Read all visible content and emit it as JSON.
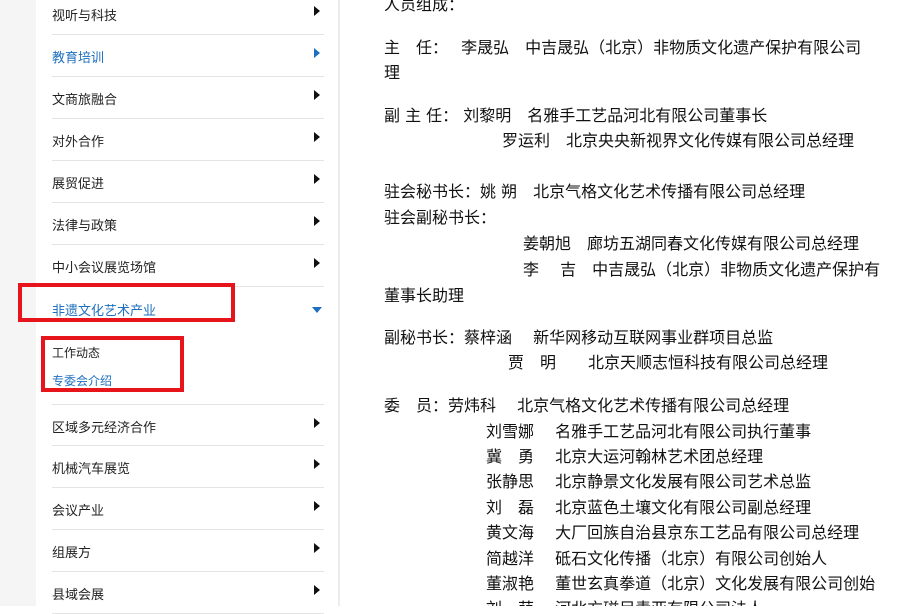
{
  "sidebar": {
    "items": [
      {
        "label": "视听与科技",
        "state": "collapsed"
      },
      {
        "label": "教育培训",
        "state": "collapsed",
        "highlight": true
      },
      {
        "label": "文商旅融合",
        "state": "collapsed"
      },
      {
        "label": "对外合作",
        "state": "collapsed"
      },
      {
        "label": "展贸促进",
        "state": "collapsed"
      },
      {
        "label": "法律与政策",
        "state": "collapsed"
      },
      {
        "label": "中小会议展览场馆",
        "state": "collapsed"
      },
      {
        "label": "非遗文化艺术产业",
        "state": "expanded",
        "highlight": true
      },
      {
        "label": "区域多元经济合作",
        "state": "collapsed"
      },
      {
        "label": "机械汽车展览",
        "state": "collapsed"
      },
      {
        "label": "会议产业",
        "state": "collapsed"
      },
      {
        "label": "组展方",
        "state": "collapsed"
      },
      {
        "label": "县域会展",
        "state": "collapsed"
      }
    ],
    "subitems": [
      {
        "label": "工作动态"
      },
      {
        "label": "专委会介绍",
        "active": true
      }
    ]
  },
  "content": {
    "lines": [
      "人员组成：",
      "主　任：　 李晟弘　中吉晟弘（北京）非物质文化遗产保护有限公司",
      "理",
      "副 主 任：  刘黎明　名雅手工艺品河北有限公司董事长",
      "罗运利　北京央央新视界文化传媒有限公司总经理",
      "驻会秘书长：姚  朔　北京气格文化艺术传播有限公司总经理",
      "驻会副秘书长：",
      "姜朝旭　廊坊五湖同春文化传媒有限公司总经理",
      "李　 吉　中吉晟弘（北京）非物质文化遗产保护有",
      "董事长助理",
      "副秘书长：蔡梓涵　 新华网移动互联网事业群项目总监",
      "贾　明　　北京天顺志恒科技有限公司总经理",
      "委　员：劳炜科　 北京气格文化艺术传播有限公司总经理",
      "刘雪娜　 名雅手工艺品河北有限公司执行董事",
      "冀　勇　 北京大运河翰林艺术团总经理",
      "张静思　 北京静景文化发展有限公司艺术总监",
      "刘　磊　 北京蓝色土壤文化有限公司副总经理",
      "黄文海　 大厂回族自治县京东工艺品有限公司总经理",
      "简越洋　 砥石文化传播（北京）有限公司创始人",
      "董淑艳　 董世玄真拳道（北京）文化发展有限公司创始",
      "刘　萌　 河北方磁足青亚有限公司法人"
    ]
  },
  "colors": {
    "link": "#1e6fbf",
    "highlight_box": "#e8141c"
  }
}
